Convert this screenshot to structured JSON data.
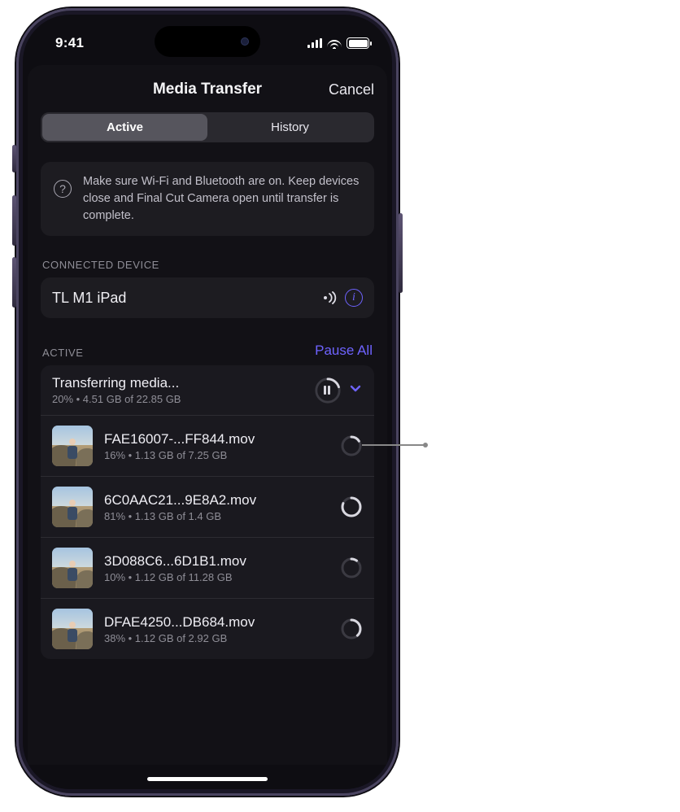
{
  "status": {
    "time": "9:41"
  },
  "nav": {
    "title": "Media Transfer",
    "cancel": "Cancel"
  },
  "tabs": {
    "active": "Active",
    "history": "History"
  },
  "info": {
    "text": "Make sure Wi-Fi and Bluetooth are on. Keep devices close and Final Cut Camera open until transfer is complete."
  },
  "device": {
    "section": "CONNECTED DEVICE",
    "name": "TL M1 iPad"
  },
  "active": {
    "section": "ACTIVE",
    "pause_all": "Pause All",
    "summary": {
      "title": "Transferring media...",
      "sub": "20% • 4.51 GB of 22.85 GB",
      "progress": 20
    },
    "files": [
      {
        "name": "FAE16007-...FF844.mov",
        "sub": "16% • 1.13 GB of 7.25 GB",
        "progress": 16
      },
      {
        "name": "6C0AAC21...9E8A2.mov",
        "sub": "81% • 1.13 GB of 1.4 GB",
        "progress": 81
      },
      {
        "name": "3D088C6...6D1B1.mov",
        "sub": "10% • 1.12 GB of 11.28 GB",
        "progress": 10
      },
      {
        "name": "DFAE4250...DB684.mov",
        "sub": "38% • 1.12 GB of 2.92 GB",
        "progress": 38
      }
    ]
  }
}
